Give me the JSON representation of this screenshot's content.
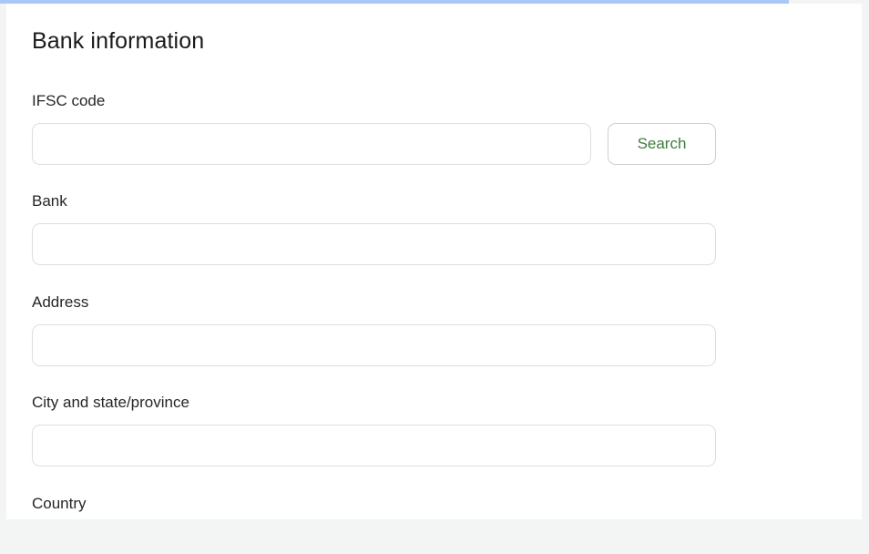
{
  "section": {
    "title": "Bank information"
  },
  "fields": {
    "ifsc": {
      "label": "IFSC code",
      "value": ""
    },
    "bank": {
      "label": "Bank",
      "value": ""
    },
    "address": {
      "label": "Address",
      "value": ""
    },
    "city_state": {
      "label": "City and state/province",
      "value": ""
    },
    "country": {
      "label": "Country"
    }
  },
  "buttons": {
    "search_label": "Search"
  },
  "colors": {
    "accent_text": "#3e7d3c",
    "banner": "#a9c8f3",
    "input_border": "#dedede",
    "page_background": "#f3f4f4"
  }
}
